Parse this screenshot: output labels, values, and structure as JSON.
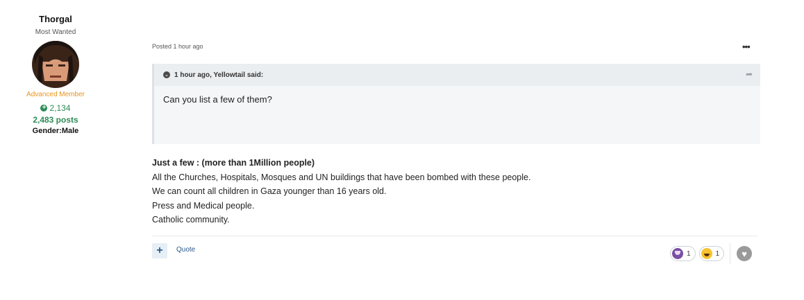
{
  "author": {
    "name": "Thorgal",
    "title": "Most Wanted",
    "group": "Advanced Member",
    "reputation": "2,134",
    "posts": "2,483 posts",
    "gender": "Gender:Male"
  },
  "post": {
    "meta": "Posted 1 hour ago",
    "more_label": "•••",
    "quote": {
      "cite": "1 hour ago, Yellowtail said:",
      "text": "Can you list a few of them?"
    },
    "lead": "Just a few : (more than 1Million people)",
    "lines": [
      "All the Churches, Hospitals, Mosques and UN buildings that have been bombed with these people.",
      "We can count all children in Gaza younger than 16 years old.",
      "Press and Medical people.",
      "Catholic community."
    ]
  },
  "footer": {
    "plus_label": "+",
    "quote_label": "Quote",
    "reactions": [
      {
        "icon": "trophy-icon",
        "count": "1"
      },
      {
        "icon": "laugh-icon",
        "count": "1"
      }
    ]
  },
  "colors": {
    "reputation": "#2e8b57",
    "group": "#e8951c",
    "link": "#2a5a8c"
  }
}
